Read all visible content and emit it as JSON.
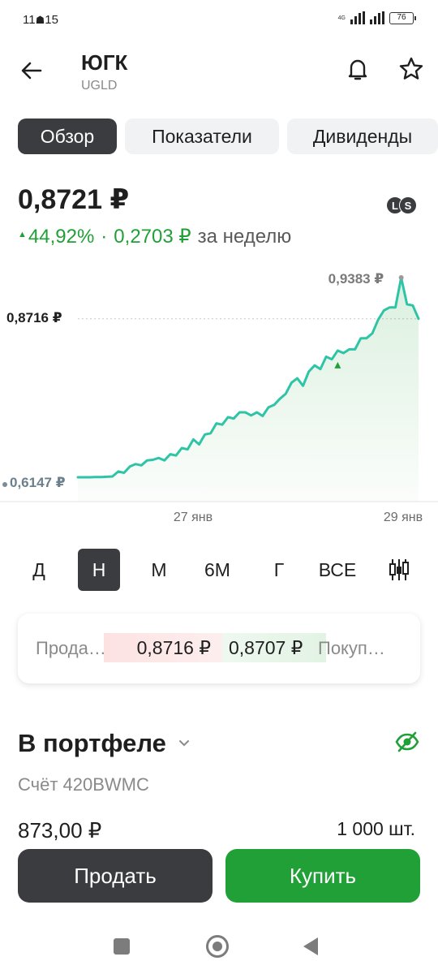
{
  "status_bar": {
    "time": "11",
    "network": "4G",
    "battery": "76"
  },
  "header": {
    "title": "ЮГК",
    "ticker": "UGLD"
  },
  "tabs": [
    {
      "label": "Обзор",
      "active": true
    },
    {
      "label": "Показатели",
      "active": false
    },
    {
      "label": "Дивиденды",
      "active": false
    }
  ],
  "price": {
    "current": "0,8721 ₽",
    "change_percent": "44,92%",
    "change_separator": "·",
    "change_value": "0,2703 ₽",
    "period_text": "за неделю",
    "badges": [
      "L",
      "S"
    ]
  },
  "chart_data": {
    "type": "area",
    "x_labels": [
      "27 янв",
      "29 янв"
    ],
    "max_label": "0,9383 ₽",
    "min_label": "0,6147 ₽",
    "current_label": "0,8716 ₽",
    "max": 0.9383,
    "min": 0.6147,
    "current": 0.8716,
    "line_color": "#2ec4a6",
    "end_line_color": "#21a038",
    "values": [
      0.6147,
      0.6147,
      0.6147,
      0.615,
      0.615,
      0.6155,
      0.616,
      0.624,
      0.622,
      0.632,
      0.636,
      0.634,
      0.642,
      0.643,
      0.646,
      0.642,
      0.652,
      0.65,
      0.662,
      0.66,
      0.676,
      0.668,
      0.684,
      0.686,
      0.702,
      0.7,
      0.712,
      0.71,
      0.72,
      0.72,
      0.715,
      0.72,
      0.714,
      0.728,
      0.732,
      0.742,
      0.75,
      0.768,
      0.775,
      0.763,
      0.786,
      0.796,
      0.79,
      0.81,
      0.806,
      0.82,
      0.816,
      0.822,
      0.822,
      0.84,
      0.84,
      0.848,
      0.87,
      0.885,
      0.89,
      0.89,
      0.9383,
      0.895,
      0.893,
      0.8716
    ],
    "marker_index": 45
  },
  "periods": [
    {
      "label": "Д",
      "active": false
    },
    {
      "label": "Н",
      "active": true
    },
    {
      "label": "М",
      "active": false
    },
    {
      "label": "6М",
      "active": false
    },
    {
      "label": "Г",
      "active": false
    },
    {
      "label": "ВСЕ",
      "active": false
    }
  ],
  "orderbook": {
    "sell_label": "Прода…",
    "sell_price": "0,8716 ₽",
    "buy_price": "0,8707 ₽",
    "buy_label": "Покуп…"
  },
  "portfolio": {
    "title": "В портфеле",
    "account": "Счёт 420BWMC",
    "value": "873,00 ₽",
    "quantity": "1 000 шт."
  },
  "actions": {
    "sell": "Продать",
    "buy": "Купить"
  },
  "colors": {
    "accent_green": "#21a038",
    "dark": "#3a3c40",
    "chart_line": "#2ec4a6"
  }
}
